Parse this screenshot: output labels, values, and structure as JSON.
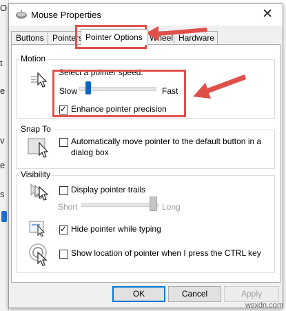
{
  "background": {
    "letters": [
      "O",
      "t",
      "e",
      "v",
      "e",
      "s"
    ]
  },
  "window": {
    "title": "Mouse Properties",
    "close_glyph": "✕"
  },
  "tabs": [
    {
      "label": "Buttons"
    },
    {
      "label": "Pointers"
    },
    {
      "label": "Pointer Options",
      "active": true
    },
    {
      "label": "Wheel"
    },
    {
      "label": "Hardware"
    }
  ],
  "motion": {
    "legend": "Motion",
    "speed_label": "Select a pointer speed:",
    "slow_label": "Slow",
    "fast_label": "Fast",
    "speed_level": 0.09,
    "precision_label": "Enhance pointer precision",
    "precision_checked": true
  },
  "snap_to": {
    "legend": "Snap To",
    "label_line1": "Automatically move pointer to the default button in a",
    "label_line2": "dialog box",
    "checked": false
  },
  "visibility": {
    "legend": "Visibility",
    "trails_label": "Display pointer trails",
    "trails_checked": false,
    "short_label": "Short",
    "long_label": "Long",
    "trails_level": 1.0,
    "hide_label": "Hide pointer while typing",
    "hide_checked": true,
    "ctrl_label": "Show location of pointer when I press the CTRL key",
    "ctrl_checked": false
  },
  "buttons": {
    "ok": "OK",
    "cancel": "Cancel",
    "apply": "Apply"
  },
  "check_glyph": "✓",
  "annotation_color": "#e0504a",
  "watermark": "wsxdn.com"
}
